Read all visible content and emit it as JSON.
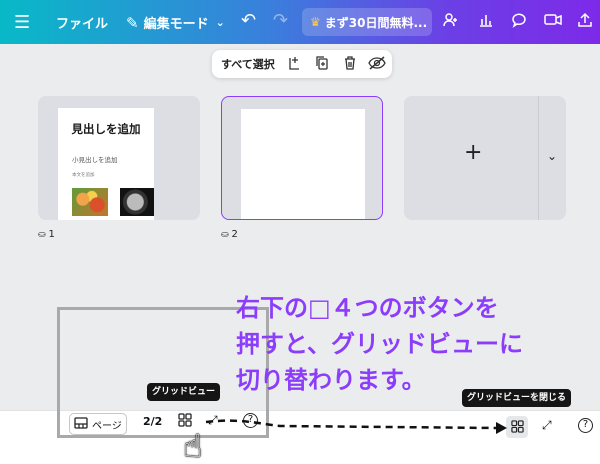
{
  "topbar": {
    "menu_icon": "hamburger-icon",
    "file_label": "ファイル",
    "edit_mode_label": "編集モード",
    "promo_label": "まず30日間無料...",
    "icons": [
      "undo-icon",
      "redo-icon",
      "share-people-icon",
      "analytics-icon",
      "comment-icon",
      "present-icon",
      "upload-icon"
    ],
    "gradient_colors": [
      "#08b9c7",
      "#3a7fdc",
      "#7d2ae8"
    ]
  },
  "selection_toolbar": {
    "select_all_label": "すべて選択",
    "icons": [
      "add-page-icon",
      "duplicate-icon",
      "trash-icon",
      "hide-icon"
    ]
  },
  "pages": [
    {
      "number": "1",
      "heading": "見出しを追加",
      "subheading": "小見出しを追加",
      "body": "本文を追加"
    },
    {
      "number": "2"
    },
    {
      "add_icon": "plus-icon",
      "menu_icon": "chevron-down-icon"
    }
  ],
  "bottombar": {
    "pages_label": "ページ",
    "page_count": "2/2",
    "help_label": "?",
    "grid_tooltip": "グリッドビュー",
    "close_grid_tooltip": "グリッドビューを閉じる"
  },
  "annotation": {
    "lines": [
      "右下の□４つのボタンを",
      "押すと、グリッドビューに",
      "切り替わります。"
    ],
    "color": "#8b3dfb"
  }
}
